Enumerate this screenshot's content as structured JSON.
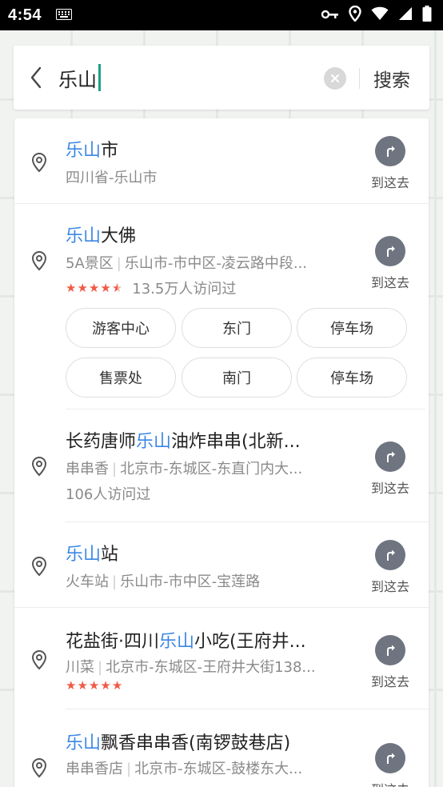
{
  "status": {
    "time": "4:54",
    "icons": [
      "keyboard-icon",
      "key-icon",
      "location-icon",
      "wifi-icon",
      "signal-icon",
      "battery-icon"
    ]
  },
  "search": {
    "query": "乐山",
    "button_label": "搜索"
  },
  "goto_label": "到这去",
  "results": [
    {
      "title_hl": "乐山",
      "title_rest": "市",
      "category": "",
      "address": "四川省-乐山市"
    },
    {
      "title_hl": "乐山",
      "title_rest": "大佛",
      "category": "5A景区",
      "address": "乐山市-市中区-凌云路中段...",
      "visits": "13.5万人访问过",
      "chips": [
        "游客中心",
        "东门",
        "停车场",
        "售票处",
        "南门",
        "停车场"
      ]
    },
    {
      "title_pre": "长药唐师",
      "title_hl": "乐山",
      "title_rest": "油炸串串(北新...",
      "category": "串串香",
      "address": "北京市-东城区-东直门内大...",
      "visits": "106人访问过"
    },
    {
      "title_hl": "乐山",
      "title_rest": "站",
      "category": "火车站",
      "address": "乐山市-市中区-宝莲路"
    },
    {
      "title_pre": "花盐街·四川",
      "title_hl": "乐山",
      "title_rest": "小吃(王府井...",
      "category": "川菜",
      "address": "北京市-东城区-王府井大街138..."
    },
    {
      "title_hl": "乐山",
      "title_rest": "飘香串串香(南锣鼓巷店)",
      "category": "串串香店",
      "address": "北京市-东城区-鼓楼东大..."
    }
  ],
  "colors": {
    "highlight": "#3b87e4",
    "star": "#f05a46",
    "goto_circle": "#6e7480",
    "caret": "#1e9e8c"
  }
}
